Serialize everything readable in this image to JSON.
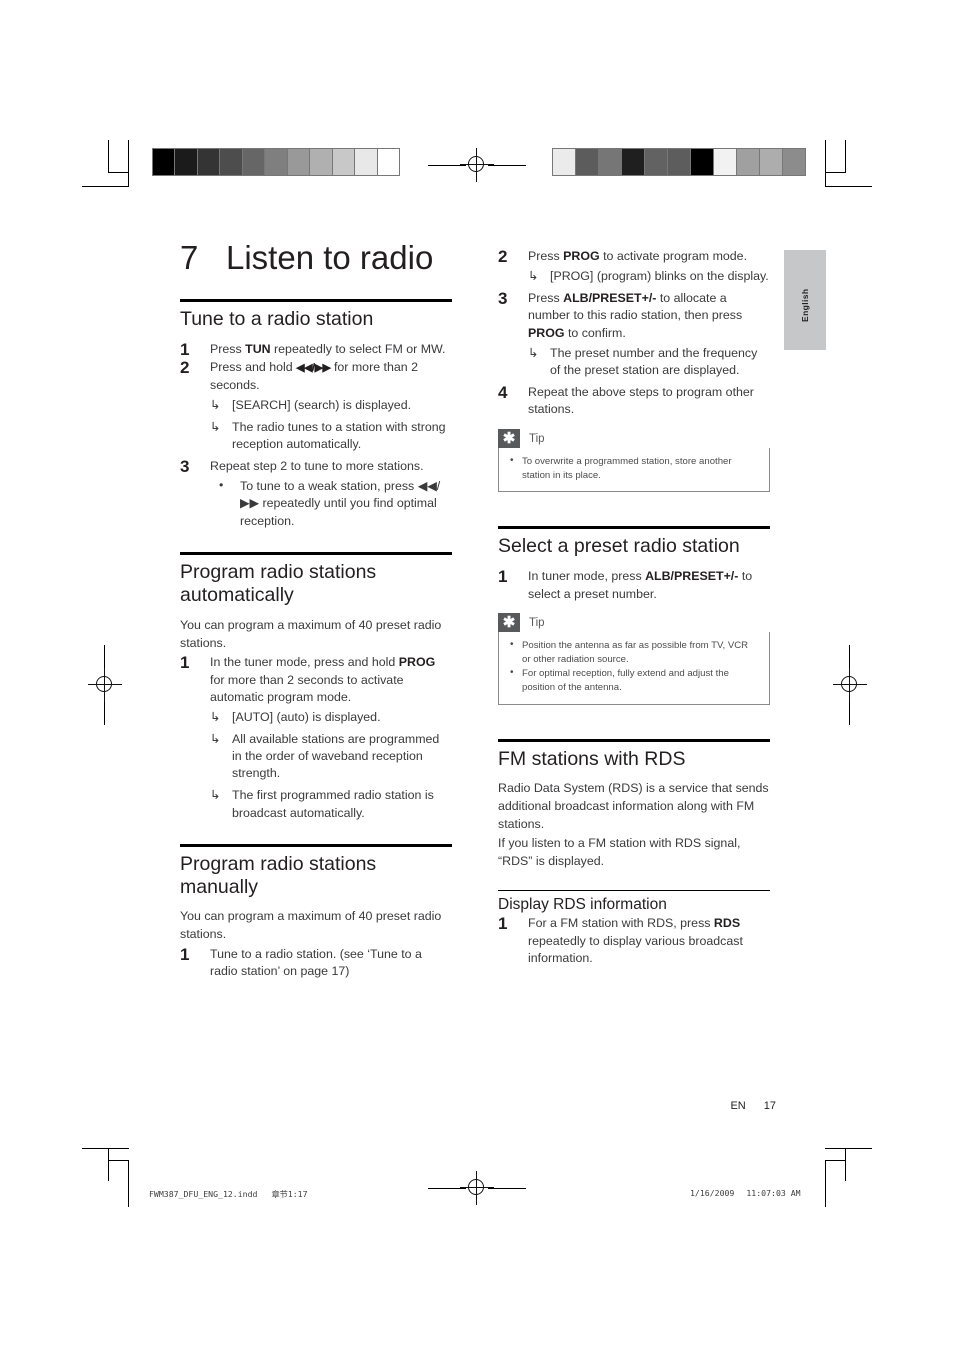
{
  "document": {
    "page_number": "17",
    "page_prefix": "EN",
    "language_tab": "English",
    "footer_file": "FWM387_DFU_ENG_12.indd",
    "footer_section": "章节1:17",
    "footer_date": "1/16/2009",
    "footer_time": "11:07:03 AM"
  },
  "chapter": {
    "number": "7",
    "title": "Listen to radio"
  },
  "colors": {
    "text": "#231f20",
    "body_text": "#3a3a3c",
    "tip_icon_bg": "#58595b",
    "tip_border": "#8a8a8d",
    "lang_tab_bg": "#c6c7c9",
    "rule": "#000000"
  },
  "colorbar_left": {
    "name": "grayscale-step-wedge",
    "swatches": [
      "#000000",
      "#1b1b1b",
      "#343434",
      "#4d4d4d",
      "#666666",
      "#7f7f7f",
      "#999999",
      "#b0b0b0",
      "#c8c8c8",
      "#e8e8e8",
      "#ffffff"
    ]
  },
  "colorbar_right": {
    "name": "density-control-patches",
    "swatches": [
      "#ebebeb",
      "#5c5c5c",
      "#767676",
      "#1f1f1f",
      "#626262",
      "#5d5d5d",
      "#000000",
      "#f2f2f2",
      "#a0a0a0",
      "#adadad",
      "#8c8c8c"
    ]
  },
  "left_column": {
    "section1": {
      "heading": "Tune to a radio station",
      "steps": [
        {
          "num": "1",
          "parts": [
            {
              "t": "Press ",
              "b": false
            },
            {
              "t": "TUN",
              "b": true
            },
            {
              "t": " repeatedly to select FM or MW.",
              "b": false
            }
          ],
          "arrows": [],
          "dots": []
        },
        {
          "num": "2",
          "parts": [
            {
              "t": "Press and hold ",
              "b": false
            },
            {
              "t": "◀◀/▶▶",
              "b": true
            },
            {
              "t": " for more than 2 seconds.",
              "b": false
            }
          ],
          "arrows": [
            "[SEARCH] (search) is displayed.",
            "The radio tunes to a station with strong reception automatically."
          ],
          "dots": []
        },
        {
          "num": "3",
          "parts": [
            {
              "t": "Repeat step 2 to tune to more stations.",
              "b": false
            }
          ],
          "arrows": [],
          "dots": [
            "To tune to a weak station, press ◀◀/▶▶ repeatedly until you find optimal reception."
          ]
        }
      ]
    },
    "section2": {
      "heading": "Program radio stations automatically",
      "intro": "You can program a maximum of 40 preset radio stations.",
      "steps": [
        {
          "num": "1",
          "parts": [
            {
              "t": "In the tuner mode, press and hold ",
              "b": false
            },
            {
              "t": "PROG",
              "b": true
            },
            {
              "t": " for more than 2 seconds to activate automatic program mode.",
              "b": false
            }
          ],
          "arrows": [
            "[AUTO] (auto) is displayed.",
            "All available stations are programmed in the order of waveband reception strength.",
            "The first programmed radio station is broadcast automatically."
          ],
          "dots": []
        }
      ]
    },
    "section3": {
      "heading": "Program radio stations manually",
      "intro": "You can program a maximum of 40 preset radio stations.",
      "steps": [
        {
          "num": "1",
          "parts": [
            {
              "t": "Tune to a radio station. (see ‘Tune to a radio station’ on page 17)",
              "b": false
            }
          ],
          "arrows": [],
          "dots": []
        }
      ]
    }
  },
  "right_column": {
    "continued_steps": [
      {
        "num": "2",
        "parts": [
          {
            "t": "Press ",
            "b": false
          },
          {
            "t": "PROG",
            "b": true
          },
          {
            "t": " to activate program mode.",
            "b": false
          }
        ],
        "arrows": [
          "[PROG] (program) blinks on the display."
        ],
        "dots": []
      },
      {
        "num": "3",
        "parts": [
          {
            "t": "Press ",
            "b": false
          },
          {
            "t": "ALB/PRESET+/-",
            "b": true
          },
          {
            "t": " to allocate a number to this radio station, then press ",
            "b": false
          },
          {
            "t": "PROG",
            "b": true
          },
          {
            "t": " to confirm.",
            "b": false
          }
        ],
        "arrows": [
          "The preset number and the frequency of the preset station are displayed."
        ],
        "dots": []
      },
      {
        "num": "4",
        "parts": [
          {
            "t": "Repeat the above steps to program other stations.",
            "b": false
          }
        ],
        "arrows": [],
        "dots": []
      }
    ],
    "tip1": {
      "label": "Tip",
      "icon": "asterisk-icon",
      "items": [
        "To overwrite a programmed station, store another station in its place."
      ]
    },
    "section4": {
      "heading": "Select a preset radio station",
      "steps": [
        {
          "num": "1",
          "parts": [
            {
              "t": "In tuner mode, press ",
              "b": false
            },
            {
              "t": "ALB/PRESET+/-",
              "b": true
            },
            {
              "t": " to select a preset number.",
              "b": false
            }
          ],
          "arrows": [],
          "dots": []
        }
      ]
    },
    "tip2": {
      "label": "Tip",
      "icon": "asterisk-icon",
      "items": [
        "Position the antenna as far as possible from TV, VCR or other radiation source.",
        "For optimal reception, fully extend and adjust the position of the antenna."
      ]
    },
    "section5": {
      "heading": "FM stations with RDS",
      "paragraphs": [
        "Radio Data System (RDS) is a service that sends additional broadcast information along with FM stations.",
        "If you listen to a FM station with RDS signal, “RDS” is displayed."
      ],
      "subheading": "Display RDS information",
      "steps": [
        {
          "num": "1",
          "parts": [
            {
              "t": "For a FM station with RDS, press ",
              "b": false
            },
            {
              "t": "RDS",
              "b": true
            },
            {
              "t": " repeatedly to display various broadcast information.",
              "b": false
            }
          ],
          "arrows": [],
          "dots": []
        }
      ]
    }
  }
}
